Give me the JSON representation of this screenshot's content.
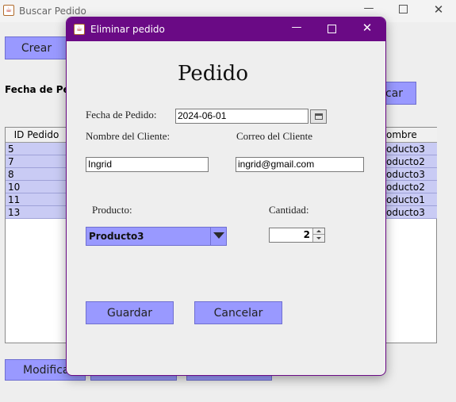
{
  "bg_window": {
    "title": "Buscar Pedido",
    "crear_label": "Crear",
    "fecha_label": "Fecha de Pedi",
    "buscar_label": "car",
    "modificar_label": "Modifica",
    "table": {
      "col_id": "ID Pedido",
      "col_producto": "ombre Pr...",
      "ids": [
        "5",
        "7",
        "8",
        "10",
        "11",
        "13"
      ],
      "productos": [
        "oducto3",
        "oducto2",
        "oducto3",
        "oducto2",
        "oducto1",
        "oducto3"
      ]
    }
  },
  "dialog": {
    "title": "Eliminar pedido",
    "heading": "Pedido",
    "fecha_label": "Fecha de Pedido:",
    "fecha_value": "2024-06-01",
    "nombre_label": "Nombre del Cliente:",
    "nombre_value": "Ingrid",
    "correo_label": "Correo del Cliente",
    "correo_value": "ingrid@gmail.com",
    "producto_label": "Producto:",
    "producto_value": "Producto3",
    "cantidad_label": "Cantidad:",
    "cantidad_value": "2",
    "guardar_label": "Guardar",
    "cancelar_label": "Cancelar"
  },
  "colors": {
    "accent": "#9999ff",
    "dialog_titlebar": "#6a0a85",
    "row_highlight": "#c9cbf4"
  },
  "icons": {
    "minimize": "—",
    "maximize": "☐",
    "close": "✕",
    "calendar": "calendar-icon",
    "dropdown": "▼",
    "spinner_up": "▲",
    "spinner_down": "▼"
  }
}
